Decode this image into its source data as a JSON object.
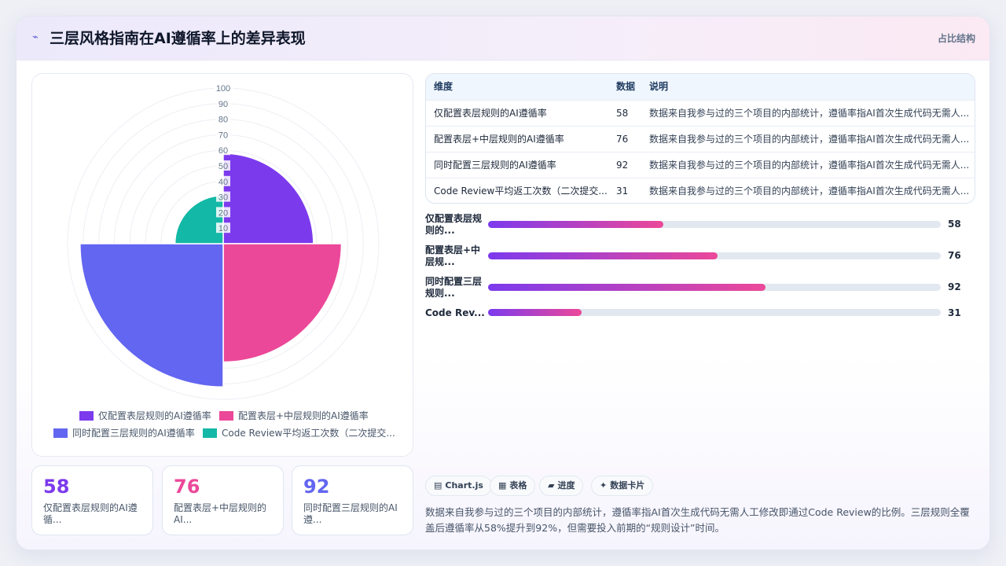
{
  "header": {
    "title": "三层风格指南在AI遵循率上的差异表现",
    "tag": "占比结构"
  },
  "colors": {
    "violet": "#7c3aed",
    "pink": "#ec4899",
    "indigo": "#6366f1",
    "teal": "#14b8a6"
  },
  "chart_data": {
    "type": "polarArea",
    "categories": [
      "仅配置表层规则的AI遵循率",
      "配置表层+中层规则的AI遵循率",
      "同时配置三层规则的AI遵循率",
      "Code Review平均返工次数（二次提交..."
    ],
    "values": [
      58,
      76,
      92,
      31
    ],
    "series_colors": [
      "#7c3aed",
      "#ec4899",
      "#6366f1",
      "#14b8a6"
    ],
    "rlim": [
      0,
      100
    ],
    "ticks": [
      "10",
      "20",
      "30",
      "40",
      "50",
      "60",
      "70",
      "80",
      "90",
      "100"
    ],
    "legend_position": "bottom"
  },
  "legend": [
    {
      "label": "仅配置表层规则的AI遵循率"
    },
    {
      "label": "配置表层+中层规则的AI遵循率"
    },
    {
      "label": "同时配置三层规则的AI遵循率"
    },
    {
      "label": "Code Review平均返工次数（二次提交..."
    }
  ],
  "stats": [
    {
      "value": "58",
      "label": "仅配置表层规则的AI遵循...",
      "color": "#7c3aed"
    },
    {
      "value": "76",
      "label": "配置表层+中层规则的AI...",
      "color": "#ec4899"
    },
    {
      "value": "92",
      "label": "同时配置三层规则的AI遵...",
      "color": "#6366f1"
    }
  ],
  "table": {
    "headers": [
      "维度",
      "数据",
      "说明"
    ],
    "rows": [
      [
        "仅配置表层规则的AI遵循率",
        "58",
        "数据来自我参与过的三个项目的内部统计，遵循率指AI首次生成代码无需人..."
      ],
      [
        "配置表层+中层规则的AI遵循率",
        "76",
        "数据来自我参与过的三个项目的内部统计，遵循率指AI首次生成代码无需人..."
      ],
      [
        "同时配置三层规则的AI遵循率",
        "92",
        "数据来自我参与过的三个项目的内部统计，遵循率指AI首次生成代码无需人..."
      ],
      [
        "Code Review平均返工次数（二次提交...",
        "31",
        "数据来自我参与过的三个项目的内部统计，遵循率指AI首次生成代码无需人..."
      ]
    ]
  },
  "bars": [
    {
      "label": "仅配置表层规则的...",
      "value": 58,
      "display": "58"
    },
    {
      "label": "配置表层+中层规...",
      "value": 76,
      "display": "76"
    },
    {
      "label": "同时配置三层规则...",
      "value": 92,
      "display": "92"
    },
    {
      "label": "Code Rev...",
      "value": 31,
      "display": "31"
    }
  ],
  "bar_max": 150,
  "chips": [
    {
      "icon": "▤",
      "label": "Chart.js"
    },
    {
      "icon": "▦",
      "label": "表格"
    },
    {
      "icon": "▰",
      "label": "进度"
    },
    {
      "icon": "✦",
      "label": "数据卡片"
    }
  ],
  "note": "数据来自我参与过的三个项目的内部统计，遵循率指AI首次生成代码无需人工修改即通过Code Review的比例。三层规则全覆盖后遵循率从58%提升到92%，但需要投入前期的“规则设计”时间。"
}
